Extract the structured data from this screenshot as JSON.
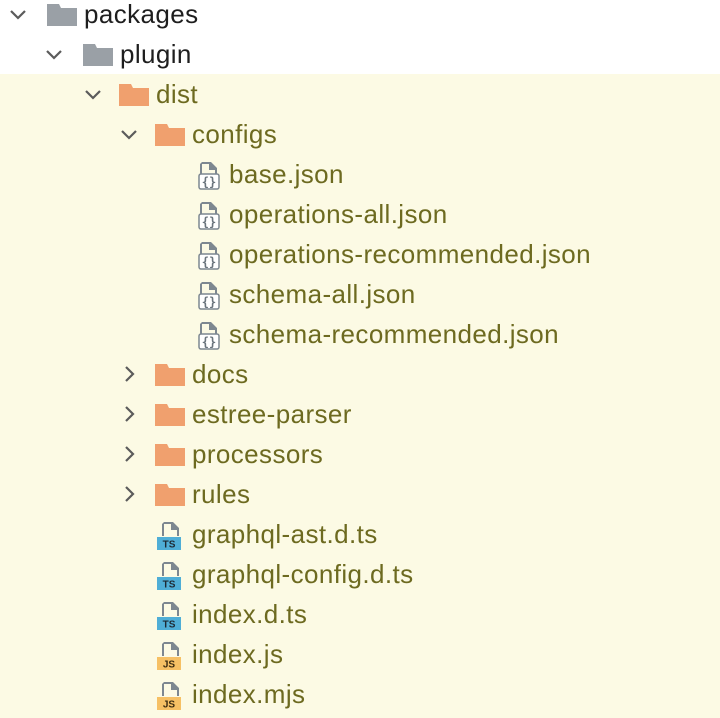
{
  "colors": {
    "root_text": "#1e1e1e",
    "dist_text": "#6d6a20",
    "dist_background": "#fcfae4",
    "folder_gray": "#9aa0a6",
    "folder_orange": "#f0a06e",
    "json_icon": "#7d8790",
    "ts_badge": "#4faed6",
    "js_badge": "#f6c064",
    "chevron": "#5b5b5b"
  },
  "tree": {
    "packages": "packages",
    "plugin": "plugin",
    "dist": "dist",
    "configs": "configs",
    "base_json": "base.json",
    "operations_all": "operations-all.json",
    "operations_recommended": "operations-recommended.json",
    "schema_all": "schema-all.json",
    "schema_recommended": "schema-recommended.json",
    "docs": "docs",
    "estree_parser": "estree-parser",
    "processors": "processors",
    "rules": "rules",
    "graphql_ast": "graphql-ast.d.ts",
    "graphql_config": "graphql-config.d.ts",
    "index_dts": "index.d.ts",
    "index_js": "index.js",
    "index_mjs": "index.mjs"
  },
  "icons": {
    "expanded": "chevron-down-icon",
    "collapsed": "chevron-right-icon",
    "folder_gray": "folder-icon",
    "folder_orange": "folder-icon",
    "json": "json-file-icon",
    "ts": "typescript-file-icon",
    "js": "javascript-file-icon"
  },
  "badges": {
    "ts": "TS",
    "js": "JS"
  }
}
